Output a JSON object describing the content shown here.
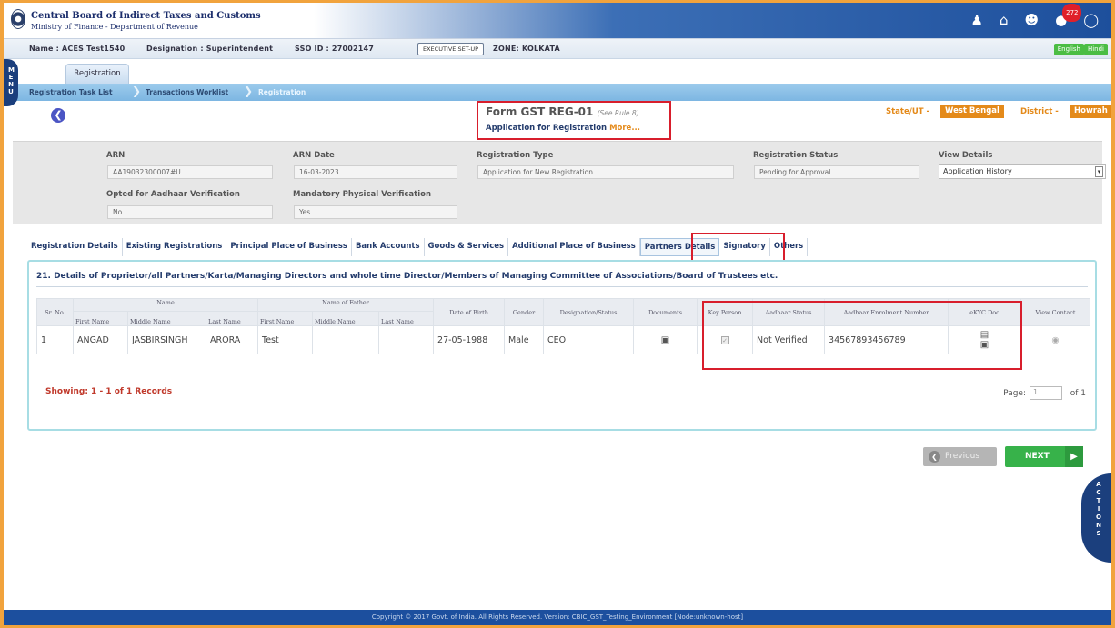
{
  "header": {
    "org_name": "Central Board of Indirect Taxes and Customs",
    "org_sub": "Ministry of Finance - Department of Revenue",
    "notification_count": "272",
    "icons": [
      "users-icon",
      "home-icon",
      "user-icon",
      "notification-icon",
      "power-icon"
    ]
  },
  "infobar": {
    "name": "Name : ACES Test1540",
    "designation": "Designation : Superintendent",
    "sso": "SSO ID : 27002147",
    "exec_setup": "EXECUTIVE SET-UP",
    "zone": "ZONE: KOLKATA",
    "lang_en": "English",
    "lang_hi": "Hindi"
  },
  "menu": {
    "label": "MENU"
  },
  "registration_tab": "Registration",
  "breadcrumb": [
    "Registration Task List",
    "Transactions Worklist",
    "Registration"
  ],
  "form": {
    "title": "Form GST REG-01",
    "rule": "(See Rule 8)",
    "subtitle": "Application for Registration",
    "more": "More..."
  },
  "location": {
    "state_label": "State/UT -",
    "state_value": "West Bengal",
    "district_label": "District -",
    "district_value": "Howrah"
  },
  "details": {
    "arn_label": "ARN",
    "arn_value": "AA19032300007#U",
    "arn_date_label": "ARN Date",
    "arn_date_value": "16-03-2023",
    "reg_type_label": "Registration Type",
    "reg_type_value": "Application for New Registration",
    "reg_status_label": "Registration Status",
    "reg_status_value": "Pending for Approval",
    "view_details_label": "View Details",
    "view_details_value": "Application History",
    "aadhaar_label": "Opted for Aadhaar Verification",
    "aadhaar_value": "No",
    "physical_label": "Mandatory Physical Verification",
    "physical_value": "Yes"
  },
  "tabs": [
    "Registration Details",
    "Existing Registrations",
    "Principal Place of Business",
    "Bank Accounts",
    "Goods & Services",
    "Additional Place of Business",
    "Partners Details",
    "Signatory",
    "Others"
  ],
  "active_tab": "Partners Details",
  "section_title": "21. Details of Proprietor/all Partners/Karta/Managing Directors and whole time Director/Members of Managing Committee of Associations/Board of Trustees etc.",
  "table": {
    "group_name": "Name",
    "group_father": "Name of Father",
    "headers": {
      "sr": "Sr. No.",
      "first": "First Name",
      "middle": "Middle Name",
      "last": "Last Name",
      "f_first": "First Name",
      "f_middle": "Middle Name",
      "f_last": "Last Name",
      "dob": "Date of Birth",
      "gender": "Gender",
      "designation": "Designation/Status",
      "documents": "Documents",
      "key_person": "Key Person",
      "aadhaar_status": "Aadhaar Status",
      "aadhaar_number": "Aadhaar Enrolment Number",
      "ekyc": "eKYC Doc",
      "view_contact": "View Contact"
    },
    "rows": [
      {
        "sr": "1",
        "first": "ANGAD",
        "middle": "JASBIRSINGH",
        "last": "ARORA",
        "f_first": "Test",
        "f_middle": "",
        "f_last": "",
        "dob": "27-05-1988",
        "gender": "Male",
        "designation": "CEO",
        "aadhaar_status": "Not Verified",
        "aadhaar_number": "34567893456789"
      }
    ]
  },
  "pagination": {
    "showing": "Showing: 1 - 1 of 1 Records",
    "page_label": "Page:",
    "page_value": "1",
    "of_label": "of 1"
  },
  "buttons": {
    "previous": "Previous",
    "next": "NEXT"
  },
  "actions_tab": "ACTIONS",
  "footer": "Copyright © 2017 Govt. of India. All Rights Reserved. Version: CBIC_GST_Testing_Environment    [Node:unknown-host]"
}
